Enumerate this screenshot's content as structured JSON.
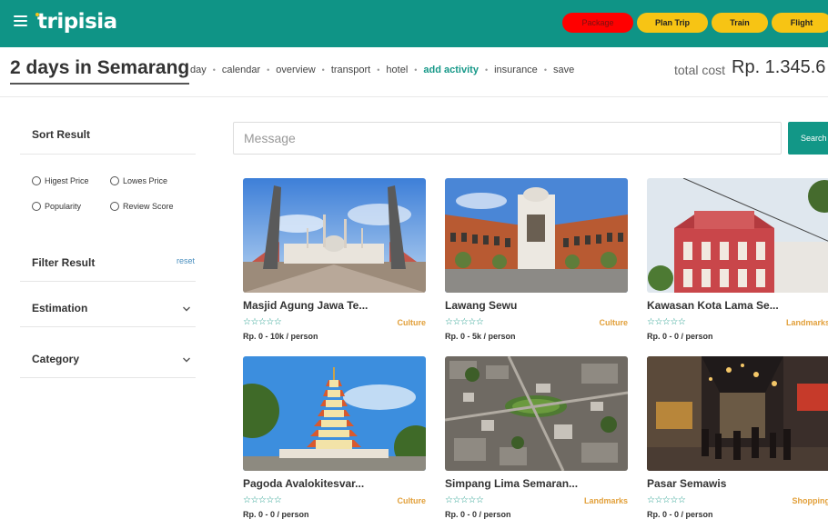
{
  "app": {
    "logo": "tripisia"
  },
  "nav": {
    "package": "Package",
    "plan_trip": "Plan Trip",
    "train": "Train",
    "flight": "Flight"
  },
  "header": {
    "title": "2 days in Semarang",
    "subnav": [
      "day",
      "calendar",
      "overview",
      "transport",
      "hotel",
      "add activity",
      "insurance",
      "save"
    ],
    "active": "add activity",
    "total_label": "total cost",
    "total_value": "Rp. 1.345.6"
  },
  "sidebar": {
    "sort_title": "Sort Result",
    "sort_options": [
      "Higest Price",
      "Lowes Price",
      "Popularity",
      "Review Score"
    ],
    "filter_title": "Filter Result",
    "reset": "reset",
    "estimation": "Estimation",
    "category": "Category"
  },
  "search": {
    "placeholder": "Message",
    "button": "Search"
  },
  "cards": [
    {
      "title": "Masjid Agung Jawa Te...",
      "category": "Culture",
      "price": "Rp. 0 - 10k / person",
      "stars": "☆☆☆☆☆"
    },
    {
      "title": "Lawang Sewu",
      "category": "Culture",
      "price": "Rp. 0 - 5k / person",
      "stars": "☆☆☆☆☆"
    },
    {
      "title": "Kawasan Kota Lama Se...",
      "category": "Landmarks",
      "price": "Rp. 0 - 0 / person",
      "stars": "☆☆☆☆☆"
    },
    {
      "title": "Pagoda Avalokitesvar...",
      "category": "Culture",
      "price": "Rp. 0 - 0 / person",
      "stars": "☆☆☆☆☆"
    },
    {
      "title": "Simpang Lima Semaran...",
      "category": "Landmarks",
      "price": "Rp. 0 - 0 / person",
      "stars": "☆☆☆☆☆"
    },
    {
      "title": "Pasar Semawis",
      "category": "Shopping",
      "price": "Rp. 0 - 0 / person",
      "stars": "☆☆☆☆☆"
    }
  ],
  "colors": {
    "brand": "#0f9486",
    "accent": "#f7c414",
    "package": "#ff0000",
    "star": "#1a9988",
    "category": "#e2a03a"
  }
}
